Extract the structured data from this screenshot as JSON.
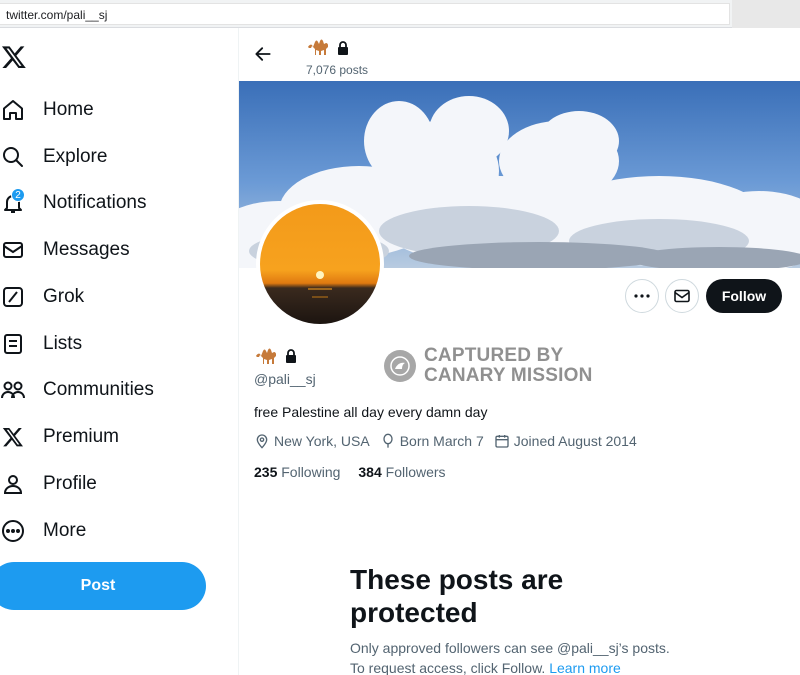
{
  "browser": {
    "url": "twitter.com/pali__sj"
  },
  "sidebar": {
    "items": [
      {
        "label": "Home",
        "icon": "home-icon"
      },
      {
        "label": "Explore",
        "icon": "search-icon"
      },
      {
        "label": "Notifications",
        "icon": "bell-icon",
        "badge": "2"
      },
      {
        "label": "Messages",
        "icon": "envelope-icon"
      },
      {
        "label": "Grok",
        "icon": "grok-icon"
      },
      {
        "label": "Lists",
        "icon": "list-icon"
      },
      {
        "label": "Communities",
        "icon": "people-icon"
      },
      {
        "label": "Premium",
        "icon": "x-icon"
      },
      {
        "label": "Profile",
        "icon": "person-icon"
      },
      {
        "label": "More",
        "icon": "more-circle-icon"
      }
    ],
    "post_label": "Post"
  },
  "header": {
    "post_count": "7,076 posts"
  },
  "profile": {
    "handle": "@pali__sj",
    "bio": "free Palestine all day every damn day",
    "location": "New York, USA",
    "born": "Born March 7",
    "joined": "Joined August 2014",
    "following_count": "235",
    "following_label": "Following",
    "followers_count": "384",
    "followers_label": "Followers",
    "follow_label": "Follow"
  },
  "watermark": {
    "line1": "CAPTURED BY",
    "line2": "CANARY MISSION"
  },
  "protected": {
    "title": "These posts are protected",
    "line1": "Only approved followers can see @pali__sj’s posts.",
    "line2": "To request access, click Follow.",
    "learn_more": "Learn more"
  },
  "colors": {
    "accent": "#1d9bf0",
    "text": "#0f1419",
    "secondary": "#536471",
    "follow_bg": "#0f1419"
  }
}
